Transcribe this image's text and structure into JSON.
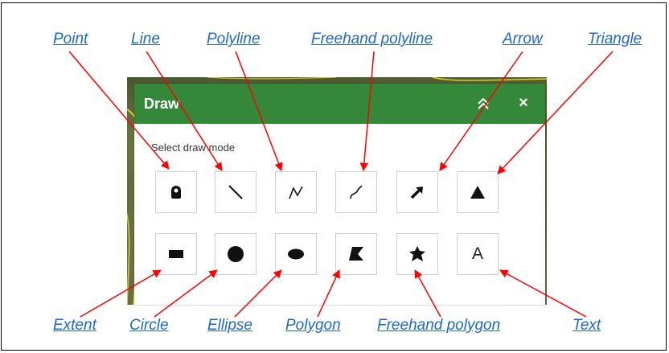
{
  "panel": {
    "title": "Draw",
    "collapse_icon": "double-chevron-up-icon",
    "close_glyph": "×",
    "mode_label": "Select draw mode"
  },
  "tools": [
    {
      "label": "Point",
      "icon": "map-pin-icon"
    },
    {
      "label": "Line",
      "icon": "line-icon"
    },
    {
      "label": "Polyline",
      "icon": "polyline-icon"
    },
    {
      "label": "Freehand polyline",
      "icon": "freehand-polyline-icon"
    },
    {
      "label": "Arrow",
      "icon": "arrow-icon"
    },
    {
      "label": "Triangle",
      "icon": "triangle-icon"
    },
    {
      "label": "Extent",
      "icon": "rectangle-icon"
    },
    {
      "label": "Circle",
      "icon": "circle-icon"
    },
    {
      "label": "Ellipse",
      "icon": "ellipse-icon"
    },
    {
      "label": "Polygon",
      "icon": "polygon-icon"
    },
    {
      "label": "Freehand polygon",
      "icon": "freehand-polygon-icon"
    },
    {
      "label": "Text",
      "icon": "text-icon",
      "glyph": "A"
    }
  ],
  "colors": {
    "header": "#35883a",
    "callout_text": "#1f68c7",
    "callout_arrow": "#ff0000"
  }
}
